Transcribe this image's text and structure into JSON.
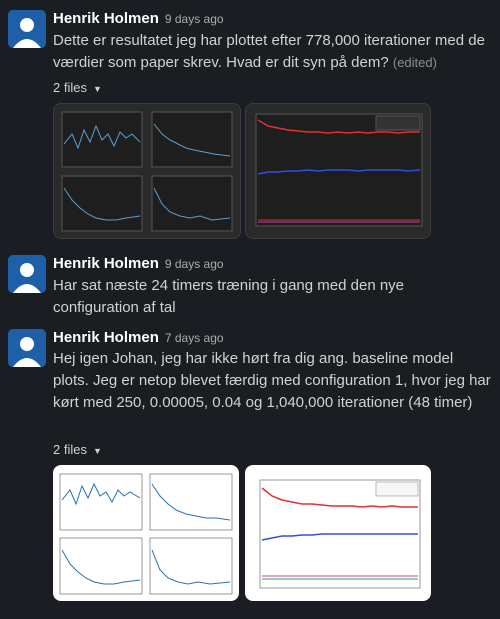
{
  "messages": [
    {
      "author": "Henrik Holmen",
      "time": "9 days ago",
      "text": "Dette er resultatet jeg har plottet efter 778,000 iterationer med de værdier som paper skrev. Hvad er dit syn på dem?",
      "edited": "(edited)",
      "files_label": "2 files"
    },
    {
      "author": "Henrik Holmen",
      "time": "9 days ago",
      "text": "Har sat næste 24 timers træning i gang med den nye configuration af tal"
    },
    {
      "author": "Henrik Holmen",
      "time": "7 days ago",
      "text": "Hej igen Johan, jeg har ikke hørt fra dig ang. baseline model plots. Jeg er netop blevet færdig med configuration 1, hvor jeg har kørt med 250, 0.00005, 0.04 og 1,040,000 iterationer (48 timer)",
      "files_label": "2 files"
    }
  ],
  "icons": {
    "files_caret": "chevron-down-icon",
    "avatar": "user-avatar-icon"
  },
  "colors": {
    "background": "#1a1d21",
    "avatar": "#1f5fa8",
    "plot_red": "#e03030",
    "plot_blue": "#3050e0"
  }
}
